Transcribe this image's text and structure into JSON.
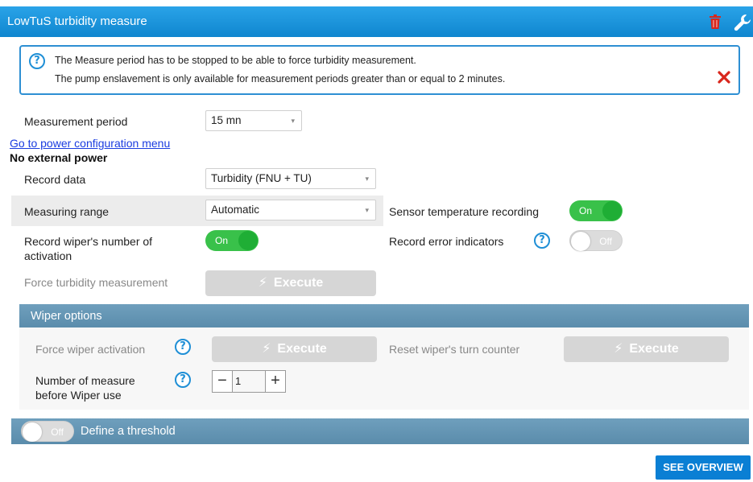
{
  "panel": {
    "title": "LowTuS turbidity measure"
  },
  "info": {
    "line1": "The Measure period has to be stopped to be able to force turbidity measurement.",
    "line2": "The pump enslavement is only available for measurement periods greater than or equal to 2 minutes."
  },
  "measurement_period": {
    "label": "Measurement period",
    "value": "15 mn"
  },
  "power_link": "Go to power configuration menu",
  "power_status": "No external power",
  "record_data": {
    "label": "Record data",
    "value": "Turbidity (FNU + TU)"
  },
  "measuring_range": {
    "label": "Measuring range",
    "value": "Automatic"
  },
  "sensor_temp": {
    "label": "Sensor temperature recording",
    "state": "On"
  },
  "wiper_activation_count": {
    "label_line1": "Record wiper's number of",
    "label_line2": "activation",
    "state": "On"
  },
  "error_indicators": {
    "label": "Record error indicators",
    "state": "Off"
  },
  "force_turbidity": {
    "label": "Force turbidity measurement",
    "button": "Execute"
  },
  "wiper": {
    "title": "Wiper options",
    "force_activation": {
      "label": "Force wiper activation",
      "button": "Execute"
    },
    "reset_counter": {
      "label": "Reset wiper's turn counter",
      "button": "Execute"
    },
    "measures_before": {
      "label_line1": "Number of measure",
      "label_line2": "before Wiper use",
      "value": "1",
      "minus": "−",
      "plus": "+"
    }
  },
  "threshold": {
    "state": "Off",
    "label": "Define a threshold"
  },
  "overview_button": "SEE OVERVIEW",
  "colors": {
    "header": "#1a92db",
    "accent_on": "#39c14a",
    "section": "#6a98b6",
    "danger": "#d9261c"
  }
}
